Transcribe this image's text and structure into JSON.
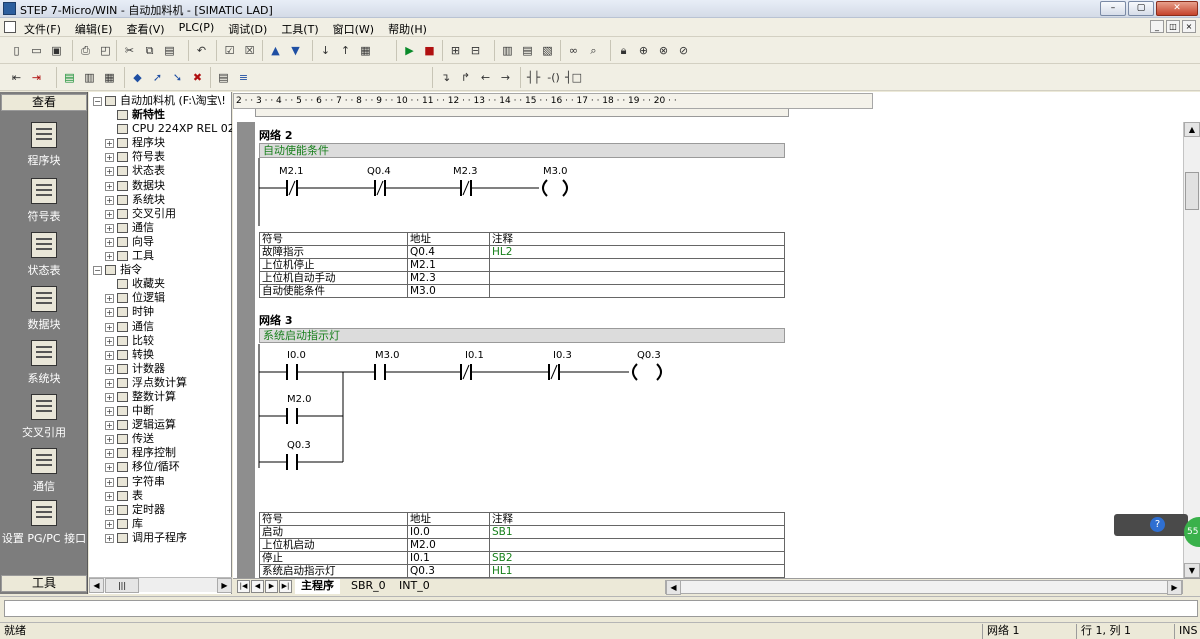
{
  "window": {
    "title": "STEP 7-Micro/WIN - 自动加料机 - [SIMATIC LAD]",
    "minimize": "–",
    "maximize": "▢",
    "close": "✕"
  },
  "menu": [
    "文件(F)",
    "编辑(E)",
    "查看(V)",
    "PLC(P)",
    "调试(D)",
    "工具(T)",
    "窗口(W)",
    "帮助(H)"
  ],
  "nav": {
    "header": "查看",
    "footer": "工具",
    "items": [
      "程序块",
      "符号表",
      "状态表",
      "数据块",
      "系统块",
      "交叉引用",
      "通信",
      "设置 PG/PC 接口"
    ]
  },
  "tree": [
    {
      "label": "自动加料机 (F:\\淘宝\\!",
      "level": 0,
      "exp": "−"
    },
    {
      "label": "新特性",
      "level": 1,
      "exp": "",
      "bold": true
    },
    {
      "label": "CPU 224XP REL 02",
      "level": 1,
      "exp": ""
    },
    {
      "label": "程序块",
      "level": 1,
      "exp": "+"
    },
    {
      "label": "符号表",
      "level": 1,
      "exp": "+"
    },
    {
      "label": "状态表",
      "level": 1,
      "exp": "+"
    },
    {
      "label": "数据块",
      "level": 1,
      "exp": "+"
    },
    {
      "label": "系统块",
      "level": 1,
      "exp": "+"
    },
    {
      "label": "交叉引用",
      "level": 1,
      "exp": "+"
    },
    {
      "label": "通信",
      "level": 1,
      "exp": "+"
    },
    {
      "label": "向导",
      "level": 1,
      "exp": "+"
    },
    {
      "label": "工具",
      "level": 1,
      "exp": "+"
    },
    {
      "label": "指令",
      "level": 0,
      "exp": "−"
    },
    {
      "label": "收藏夹",
      "level": 1,
      "exp": ""
    },
    {
      "label": "位逻辑",
      "level": 1,
      "exp": "+"
    },
    {
      "label": "时钟",
      "level": 1,
      "exp": "+"
    },
    {
      "label": "通信",
      "level": 1,
      "exp": "+"
    },
    {
      "label": "比较",
      "level": 1,
      "exp": "+"
    },
    {
      "label": "转换",
      "level": 1,
      "exp": "+"
    },
    {
      "label": "计数器",
      "level": 1,
      "exp": "+"
    },
    {
      "label": "浮点数计算",
      "level": 1,
      "exp": "+"
    },
    {
      "label": "整数计算",
      "level": 1,
      "exp": "+"
    },
    {
      "label": "中断",
      "level": 1,
      "exp": "+"
    },
    {
      "label": "逻辑运算",
      "level": 1,
      "exp": "+"
    },
    {
      "label": "传送",
      "level": 1,
      "exp": "+"
    },
    {
      "label": "程序控制",
      "level": 1,
      "exp": "+"
    },
    {
      "label": "移位/循环",
      "level": 1,
      "exp": "+"
    },
    {
      "label": "字符串",
      "level": 1,
      "exp": "+"
    },
    {
      "label": "表",
      "level": 1,
      "exp": "+"
    },
    {
      "label": "定时器",
      "level": 1,
      "exp": "+"
    },
    {
      "label": "库",
      "level": 1,
      "exp": "+"
    },
    {
      "label": "调用子程序",
      "level": 1,
      "exp": "+"
    }
  ],
  "ruler": "2 · · 3 · · 4 · · 5 · · 6 · · 7 · · 8 · · 9 · · 10 · · 11 · · 12 · · 13 · · 14 · · 15 · · 16 · · 17 · · 18 · · 19 · · 20 · ·",
  "editor": {
    "table_headers": [
      "符号",
      "地址",
      "注释"
    ],
    "network2": {
      "label": "网络 2",
      "comment": "自动使能条件",
      "contacts": [
        "M2.1",
        "Q0.4",
        "M2.3"
      ],
      "coil": "M3.0",
      "symbols": [
        [
          "故障指示",
          "Q0.4",
          "HL2"
        ],
        [
          "上位机停止",
          "M2.1",
          ""
        ],
        [
          "上位机自动手动",
          "M2.3",
          ""
        ],
        [
          "自动使能条件",
          "M3.0",
          ""
        ]
      ]
    },
    "network3": {
      "label": "网络 3",
      "comment": "系统启动指示灯",
      "contacts": [
        "I0.0",
        "M3.0",
        "I0.1",
        "I0.3"
      ],
      "parallel": [
        "M2.0",
        "Q0.3"
      ],
      "coil": "Q0.3",
      "symbols": [
        [
          "启动",
          "I0.0",
          "SB1"
        ],
        [
          "上位机启动",
          "M2.0",
          ""
        ],
        [
          "停止",
          "I0.1",
          "SB2"
        ],
        [
          "系统启动指示灯",
          "Q0.3",
          "HL1"
        ]
      ]
    },
    "tabs": [
      "主程序",
      "SBR_0",
      "INT_0"
    ]
  },
  "status": {
    "left": "就绪",
    "network": "网络 1",
    "position": "行 1, 列 1",
    "mode": "INS"
  },
  "floating": {
    "help": "?",
    "bubble": "55"
  }
}
